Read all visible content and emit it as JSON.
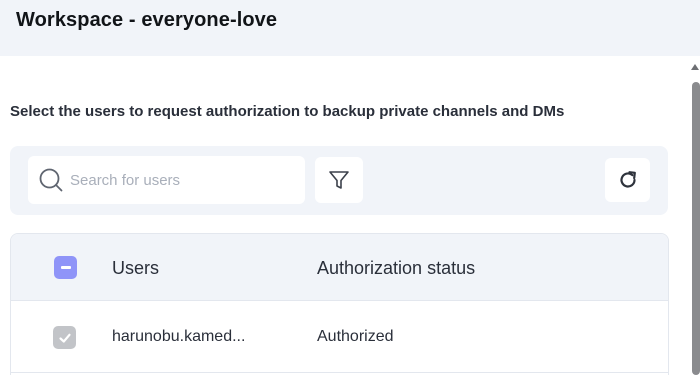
{
  "header": {
    "title": "Workspace - everyone-love"
  },
  "instructions": "Select the users to request authorization to backup private channels and DMs",
  "search": {
    "placeholder": "Search for users",
    "value": ""
  },
  "toolbar": {
    "filter_icon": "filter-icon",
    "refresh_icon": "refresh-icon"
  },
  "table": {
    "columns": [
      "Users",
      "Authorization status"
    ],
    "header_checkbox_state": "indeterminate",
    "rows": [
      {
        "user": "harunobu.kamed...",
        "status": "Authorized",
        "checked": true
      }
    ]
  },
  "colors": {
    "header_bg": "#f1f4f9",
    "accent_checkbox": "#8f94f8",
    "disabled_checkbox": "#c2c4c8"
  }
}
